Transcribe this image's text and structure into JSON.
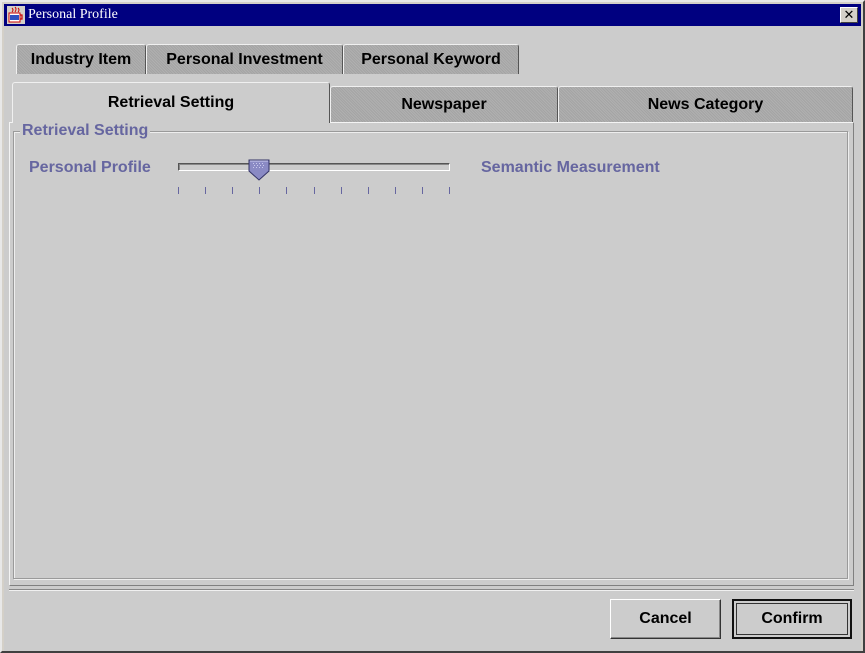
{
  "window": {
    "title": "Personal Profile",
    "close_glyph": "✕"
  },
  "tabs": {
    "row1": [
      {
        "label": "Industry Item"
      },
      {
        "label": "Personal Investment"
      },
      {
        "label": "Personal Keyword"
      }
    ],
    "row2": [
      {
        "label": "Retrieval Setting",
        "active": true
      },
      {
        "label": "Newspaper",
        "active": false
      },
      {
        "label": "News Category",
        "active": false
      }
    ]
  },
  "retrieval": {
    "group_title": "Retrieval Setting",
    "slider": {
      "left_label": "Personal Profile",
      "right_label": "Semantic Measurement",
      "min": 0,
      "max": 10,
      "value": 3,
      "tick_count": 11
    }
  },
  "buttons": {
    "cancel": "Cancel",
    "confirm": "Confirm"
  },
  "colors": {
    "title_bar": "#000080",
    "label_accent": "#6666a0",
    "background": "#cccccc"
  }
}
